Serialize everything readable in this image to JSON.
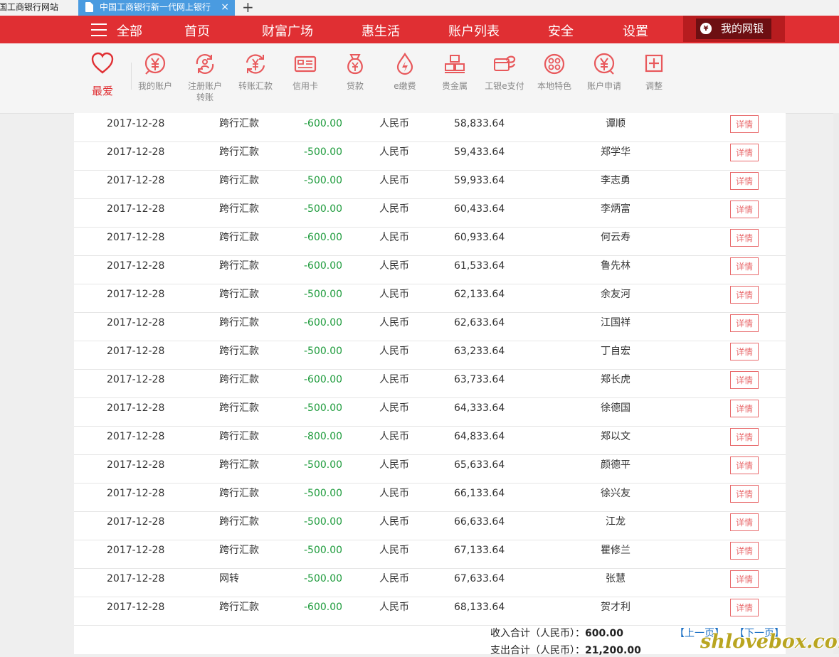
{
  "browser": {
    "tab1_title": "中国工商银行网站",
    "tab2_title": "中国工商银行新一代网上银行",
    "close_glyph": "×",
    "new_tab_glyph": "+"
  },
  "nav": {
    "all": "全部",
    "items": [
      "首页",
      "财富广场",
      "惠生活",
      "账户列表",
      "安全",
      "设置"
    ],
    "my_bank": "我的网银"
  },
  "toolbar": {
    "favorite": "最爱",
    "items": [
      {
        "label": "我的账户",
        "icon": "yen-circle-icon"
      },
      {
        "label": "注册账户转账",
        "icon": "register-transfer-icon"
      },
      {
        "label": "转账汇款",
        "icon": "transfer-icon"
      },
      {
        "label": "信用卡",
        "icon": "credit-card-icon"
      },
      {
        "label": "贷款",
        "icon": "loan-bag-icon"
      },
      {
        "label": "e缴费",
        "icon": "payment-drop-icon"
      },
      {
        "label": "贵金属",
        "icon": "gold-bars-icon"
      },
      {
        "label": "工银e支付",
        "icon": "epay-icon"
      },
      {
        "label": "本地特色",
        "icon": "local-feature-icon"
      },
      {
        "label": "账户申请",
        "icon": "account-apply-icon"
      },
      {
        "label": "调整",
        "icon": "plus-box-icon"
      }
    ]
  },
  "table": {
    "detail_label": "详情",
    "rows": [
      {
        "date": "2017-12-28",
        "type": "跨行汇款",
        "amount": "-600.00",
        "currency": "人民币",
        "balance": "58,833.64",
        "name": "谭顺"
      },
      {
        "date": "2017-12-28",
        "type": "跨行汇款",
        "amount": "-500.00",
        "currency": "人民币",
        "balance": "59,433.64",
        "name": "郑学华"
      },
      {
        "date": "2017-12-28",
        "type": "跨行汇款",
        "amount": "-500.00",
        "currency": "人民币",
        "balance": "59,933.64",
        "name": "李志勇"
      },
      {
        "date": "2017-12-28",
        "type": "跨行汇款",
        "amount": "-500.00",
        "currency": "人民币",
        "balance": "60,433.64",
        "name": "李炳富"
      },
      {
        "date": "2017-12-28",
        "type": "跨行汇款",
        "amount": "-600.00",
        "currency": "人民币",
        "balance": "60,933.64",
        "name": "何云寿"
      },
      {
        "date": "2017-12-28",
        "type": "跨行汇款",
        "amount": "-600.00",
        "currency": "人民币",
        "balance": "61,533.64",
        "name": "鲁先林"
      },
      {
        "date": "2017-12-28",
        "type": "跨行汇款",
        "amount": "-500.00",
        "currency": "人民币",
        "balance": "62,133.64",
        "name": "余友河"
      },
      {
        "date": "2017-12-28",
        "type": "跨行汇款",
        "amount": "-600.00",
        "currency": "人民币",
        "balance": "62,633.64",
        "name": "江国祥"
      },
      {
        "date": "2017-12-28",
        "type": "跨行汇款",
        "amount": "-500.00",
        "currency": "人民币",
        "balance": "63,233.64",
        "name": "丁自宏"
      },
      {
        "date": "2017-12-28",
        "type": "跨行汇款",
        "amount": "-600.00",
        "currency": "人民币",
        "balance": "63,733.64",
        "name": "郑长虎"
      },
      {
        "date": "2017-12-28",
        "type": "跨行汇款",
        "amount": "-500.00",
        "currency": "人民币",
        "balance": "64,333.64",
        "name": "徐德国"
      },
      {
        "date": "2017-12-28",
        "type": "跨行汇款",
        "amount": "-800.00",
        "currency": "人民币",
        "balance": "64,833.64",
        "name": "郑以文"
      },
      {
        "date": "2017-12-28",
        "type": "跨行汇款",
        "amount": "-500.00",
        "currency": "人民币",
        "balance": "65,633.64",
        "name": "颜德平"
      },
      {
        "date": "2017-12-28",
        "type": "跨行汇款",
        "amount": "-500.00",
        "currency": "人民币",
        "balance": "66,133.64",
        "name": "徐兴友"
      },
      {
        "date": "2017-12-28",
        "type": "跨行汇款",
        "amount": "-500.00",
        "currency": "人民币",
        "balance": "66,633.64",
        "name": "江龙"
      },
      {
        "date": "2017-12-28",
        "type": "跨行汇款",
        "amount": "-500.00",
        "currency": "人民币",
        "balance": "67,133.64",
        "name": "瞿修兰"
      },
      {
        "date": "2017-12-28",
        "type": "网转",
        "amount": "-500.00",
        "currency": "人民币",
        "balance": "67,633.64",
        "name": "张慧"
      },
      {
        "date": "2017-12-28",
        "type": "跨行汇款",
        "amount": "-600.00",
        "currency": "人民币",
        "balance": "68,133.64",
        "name": "贺才利"
      }
    ]
  },
  "summary": {
    "income_label": "收入合计（人民币）：",
    "income_value": "600.00",
    "expense_label": "支出合计（人民币）：",
    "expense_value": "21,200.00",
    "prev_page": "【上一页】",
    "next_page": "【下一页】"
  },
  "watermark": "shlovebox.com",
  "colors": {
    "brand_red": "#e02f33",
    "amount_green": "#1e9b3c",
    "link_blue": "#1a6fc4"
  }
}
